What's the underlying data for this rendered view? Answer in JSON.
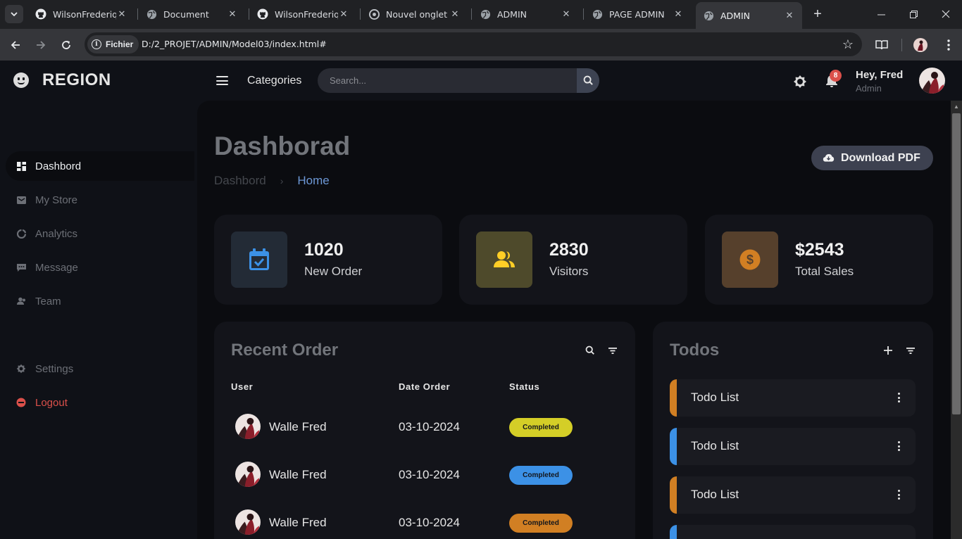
{
  "browser": {
    "tabs": [
      {
        "title": "WilsonFrederique",
        "icon": "github-icon"
      },
      {
        "title": "Document",
        "icon": "globe-icon"
      },
      {
        "title": "WilsonFrederique",
        "icon": "github-icon"
      },
      {
        "title": "Nouvel onglet",
        "icon": "chrome-icon"
      },
      {
        "title": "ADMIN",
        "icon": "globe-icon"
      },
      {
        "title": "PAGE ADMIN",
        "icon": "globe-icon"
      },
      {
        "title": "ADMIN",
        "icon": "globe-icon",
        "active": true
      }
    ],
    "file_chip": "Fichier",
    "url": "D:/2_PROJET/ADMIN/Model03/index.html#"
  },
  "header": {
    "brand": "REGION",
    "categories": "Categories",
    "search_placeholder": "Search...",
    "notification_count": "8",
    "greeting": "Hey, Fred",
    "role": "Admin"
  },
  "sidebar": {
    "items": [
      {
        "label": "Dashbord",
        "icon": "dashboard-icon",
        "active": true
      },
      {
        "label": "My Store",
        "icon": "store-icon"
      },
      {
        "label": "Analytics",
        "icon": "analytics-icon"
      },
      {
        "label": "Message",
        "icon": "message-icon"
      },
      {
        "label": "Team",
        "icon": "team-icon"
      }
    ],
    "settings": "Settings",
    "logout": "Logout"
  },
  "main": {
    "title": "Dashborad",
    "breadcrumb": [
      "Dashbord",
      "Home"
    ],
    "download_label": "Download PDF",
    "stats": [
      {
        "value": "1020",
        "label": "New Order",
        "icon": "calendar-check-icon",
        "color": "#3c91e6"
      },
      {
        "value": "2830",
        "label": "Visitors",
        "icon": "people-icon",
        "color": "#ffce26"
      },
      {
        "value": "$2543",
        "label": "Total Sales",
        "icon": "dollar-icon",
        "color": "#fd7238"
      }
    ],
    "orders": {
      "title": "Recent Order",
      "columns": [
        "User",
        "Date Order",
        "Status"
      ],
      "rows": [
        {
          "user": "Walle Fred",
          "date": "03-10-2024",
          "status": "Completed",
          "status_color": "#d4ce27"
        },
        {
          "user": "Walle Fred",
          "date": "03-10-2024",
          "status": "Completed",
          "status_color": "#3c91e6"
        },
        {
          "user": "Walle Fred",
          "date": "03-10-2024",
          "status": "Completed",
          "status_color": "#d17f23"
        }
      ]
    },
    "todos": {
      "title": "Todos",
      "items": [
        {
          "text": "Todo List",
          "color": "#d17f23"
        },
        {
          "text": "Todo List",
          "color": "#3c91e6"
        },
        {
          "text": "Todo List",
          "color": "#d17f23"
        },
        {
          "text": "",
          "color": "#3c91e6"
        }
      ]
    }
  }
}
